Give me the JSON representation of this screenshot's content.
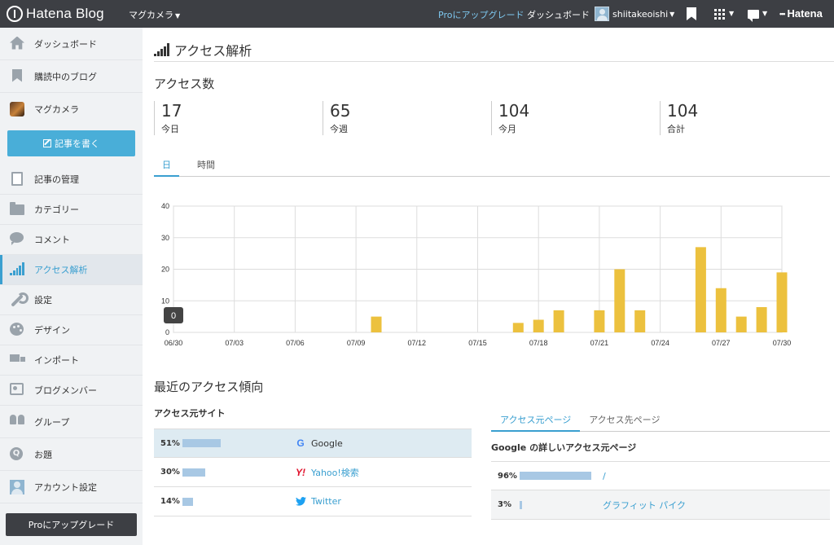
{
  "topbar": {
    "logo": "Hatena Blog",
    "blog_name": "マグカメラ",
    "pro_link": "Proにアップグレード",
    "dashboard_link": "ダッシュボード",
    "username": "shiitakeoishi",
    "hatena_brand": "Hatena"
  },
  "sidebar": {
    "items": [
      {
        "label": "ダッシュボード",
        "icon": "home-icon"
      },
      {
        "label": "購読中のブログ",
        "icon": "bookmark-icon"
      },
      {
        "label": "マグカメラ",
        "icon": "blog-thumbnail"
      },
      {
        "label": "記事の管理",
        "icon": "document-icon"
      },
      {
        "label": "カテゴリー",
        "icon": "folder-icon"
      },
      {
        "label": "コメント",
        "icon": "comment-icon"
      },
      {
        "label": "アクセス解析",
        "icon": "signal-bars-icon",
        "active": true
      },
      {
        "label": "設定",
        "icon": "wrench-icon"
      },
      {
        "label": "デザイン",
        "icon": "palette-icon"
      },
      {
        "label": "インポート",
        "icon": "truck-icon"
      },
      {
        "label": "ブログメンバー",
        "icon": "members-icon"
      },
      {
        "label": "グループ",
        "icon": "group-icon"
      },
      {
        "label": "お題",
        "icon": "question-icon"
      },
      {
        "label": "アカウント設定",
        "icon": "account-icon"
      }
    ],
    "write_button": "記事を書く",
    "pro_button": "Proにアップグレード"
  },
  "main": {
    "title": "アクセス解析",
    "access_count_title": "アクセス数",
    "stats": [
      {
        "value": "17",
        "label": "今日"
      },
      {
        "value": "65",
        "label": "今週"
      },
      {
        "value": "104",
        "label": "今月"
      },
      {
        "value": "104",
        "label": "合計"
      }
    ],
    "tabs": [
      {
        "label": "日",
        "active": true
      },
      {
        "label": "時間",
        "active": false
      }
    ],
    "tooltip_value": "0",
    "recent_trend_title": "最近のアクセス傾向",
    "sources_title": "アクセス元サイト",
    "sources": [
      {
        "pct": "51%",
        "share": 0.51,
        "name": "Google",
        "icon": "google-icon",
        "highlight": true
      },
      {
        "pct": "30%",
        "share": 0.3,
        "name": "Yahoo!検索",
        "icon": "yahoo-icon",
        "highlight": false
      },
      {
        "pct": "14%",
        "share": 0.14,
        "name": "Twitter",
        "icon": "twitter-icon",
        "highlight": false
      }
    ],
    "right_tabs": [
      {
        "label": "アクセス元ページ",
        "active": true
      },
      {
        "label": "アクセス先ページ",
        "active": false
      }
    ],
    "right_subtitle": "Google の詳しいアクセス元ページ",
    "pages": [
      {
        "pct": "96%",
        "share": 0.96,
        "name": "/"
      },
      {
        "pct": "3%",
        "share": 0.03,
        "name": "グラフィット パイク"
      }
    ]
  },
  "colors": {
    "topbar": "#3d3f44",
    "accent": "#3a9fd0",
    "bar": "#ecc13e",
    "source_bar": "#a8c8e4"
  },
  "chart_data": {
    "type": "bar",
    "x_ticks": [
      "06/30",
      "07/03",
      "07/06",
      "07/09",
      "07/12",
      "07/15",
      "07/18",
      "07/21",
      "07/24",
      "07/27",
      "07/30"
    ],
    "categories": [
      "06/30",
      "07/01",
      "07/02",
      "07/03",
      "07/04",
      "07/05",
      "07/06",
      "07/07",
      "07/08",
      "07/09",
      "07/10",
      "07/11",
      "07/12",
      "07/13",
      "07/14",
      "07/15",
      "07/16",
      "07/17",
      "07/18",
      "07/19",
      "07/20",
      "07/21",
      "07/22",
      "07/23",
      "07/24",
      "07/25",
      "07/26",
      "07/27",
      "07/28",
      "07/29",
      "07/30"
    ],
    "values": [
      0,
      0,
      0,
      0,
      0,
      0,
      0,
      0,
      0,
      0,
      5,
      0,
      0,
      0,
      0,
      0,
      0,
      3,
      4,
      7,
      0,
      7,
      20,
      7,
      0,
      0,
      27,
      14,
      5,
      8,
      19
    ],
    "yticks": [
      0,
      10,
      20,
      30,
      40
    ],
    "ylim": [
      0,
      40
    ],
    "grid": true
  }
}
